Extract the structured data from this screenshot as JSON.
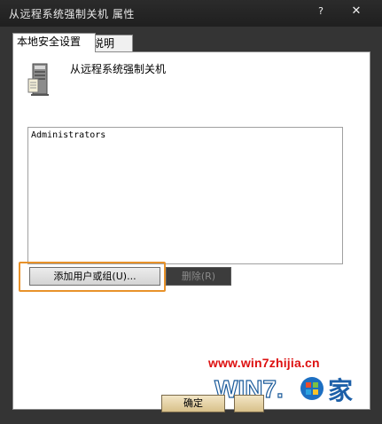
{
  "window": {
    "title": "从远程系统强制关机 属性",
    "help_glyph": "?",
    "close_glyph": "✕"
  },
  "tabs": [
    {
      "label": "本地安全设置",
      "active": true
    },
    {
      "label": "说明",
      "active": false
    }
  ],
  "policy": {
    "icon": "server-computer-icon",
    "name": "从远程系统强制关机"
  },
  "members": {
    "items": [
      "Administrators"
    ]
  },
  "buttons": {
    "add_label": "添加用户或组(U)...",
    "remove_label": "删除(R)",
    "ok_label": "确定"
  },
  "watermark": {
    "url": "www.win7zhijia.cn",
    "logo_text": "WIN7.",
    "logo_suffix": "家"
  },
  "colors": {
    "highlight": "#e8922a",
    "watermark_red": "#dd1111",
    "titlebar": "#2b2b2b"
  }
}
